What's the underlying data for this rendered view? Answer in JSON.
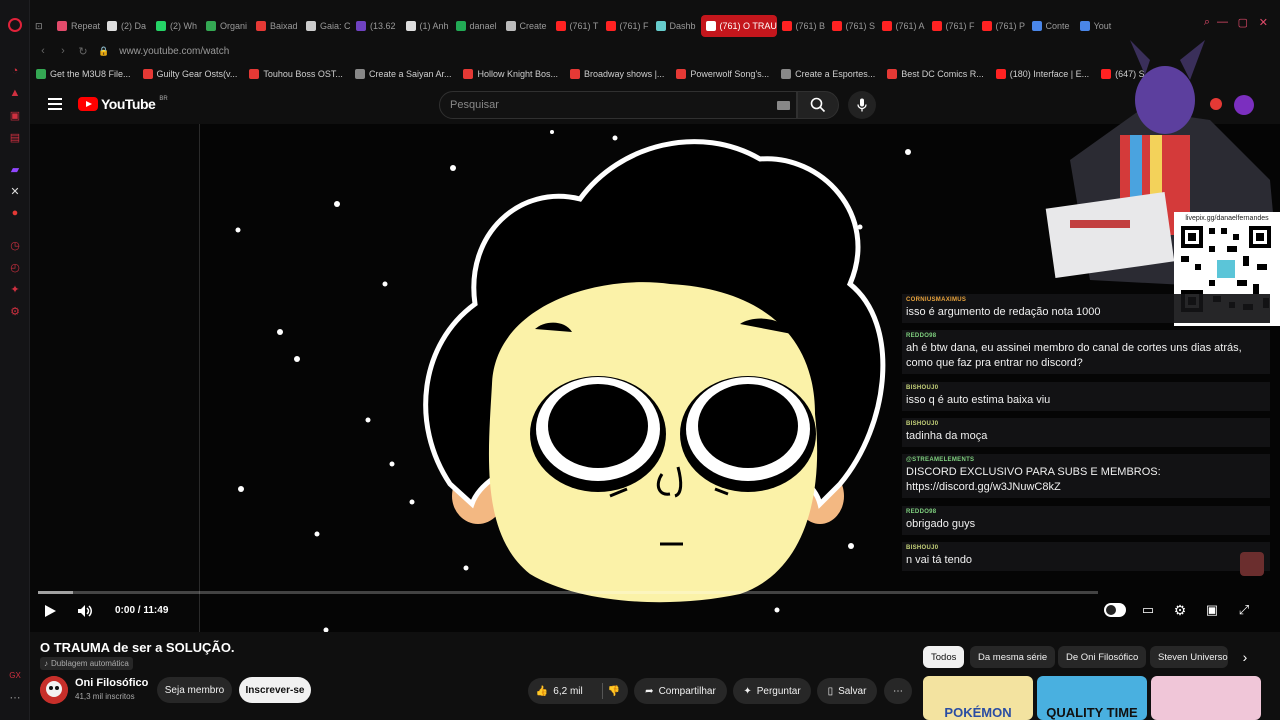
{
  "browser": {
    "tabs": [
      {
        "label": "Repeat",
        "color": "#e24b6b"
      },
      {
        "label": "(2) Da",
        "color": "#dddddd"
      },
      {
        "label": "(2) Wh",
        "color": "#25d366"
      },
      {
        "label": "Organi",
        "color": "#34a853"
      },
      {
        "label": "Baixad",
        "color": "#e53935"
      },
      {
        "label": "Gaia: C",
        "color": "#cccccc"
      },
      {
        "label": "(13.62",
        "color": "#6f42c1"
      },
      {
        "label": "(1) Anh",
        "color": "#dddddd"
      },
      {
        "label": "danael",
        "color": "#22aa55"
      },
      {
        "label": "Create",
        "color": "#bbbbbb"
      },
      {
        "label": "(761) T",
        "color": "#ff2222"
      },
      {
        "label": "(761) F",
        "color": "#ff2222"
      },
      {
        "label": "Dashb",
        "color": "#66cccc"
      },
      {
        "label": "(761) O TRAU",
        "color": "#ffffff"
      },
      {
        "label": "(761) B",
        "color": "#ff2222"
      },
      {
        "label": "(761) S",
        "color": "#ff2222"
      },
      {
        "label": "(761) A",
        "color": "#ff2222"
      },
      {
        "label": "(761) F",
        "color": "#ff2222"
      },
      {
        "label": "(761) P",
        "color": "#ff2222"
      },
      {
        "label": "Conte",
        "color": "#4a86e8"
      },
      {
        "label": "Yout",
        "color": "#4a86e8"
      }
    ],
    "url": "www.youtube.com/watch",
    "bookmarks": [
      {
        "label": "Get the M3U8 File...",
        "color": "#34a853"
      },
      {
        "label": "Guilty Gear Osts(v...",
        "color": "#e53935"
      },
      {
        "label": "Touhou Boss OST...",
        "color": "#e53935"
      },
      {
        "label": "Create a Saiyan Ar...",
        "color": "#888888"
      },
      {
        "label": "Hollow Knight Bos...",
        "color": "#e53935"
      },
      {
        "label": "Broadway shows |...",
        "color": "#e53935"
      },
      {
        "label": "Powerwolf Song's...",
        "color": "#e53935"
      },
      {
        "label": "Create a Esportes...",
        "color": "#888888"
      },
      {
        "label": "Best DC Comics R...",
        "color": "#e53935"
      },
      {
        "label": "(180) Interface | E...",
        "color": "#ff2222"
      },
      {
        "label": "(647) S",
        "color": "#ff2222"
      }
    ]
  },
  "youtube": {
    "logo_text": "YouTube",
    "country_code": "BR",
    "search_placeholder": "Pesquisar",
    "player": {
      "time": "0:00 / 11:49",
      "progress_fraction": 0
    },
    "video_title": "O TRAUMA de ser a SOLUÇÃO.",
    "dubbing_label": "Dublagem automática",
    "channel_name": "Oni Filosófico",
    "subscribers": "41,3 mil inscritos",
    "join_label": "Seja membro",
    "subscribe_label": "Inscrever-se",
    "likes": "6,2 mil",
    "share_label": "Compartilhar",
    "ask_label": "Perguntar",
    "save_label": "Salvar",
    "chips": [
      "Todos",
      "Da mesma série",
      "De Oni Filosófico",
      "Steven Universo"
    ],
    "thumbs": [
      {
        "label": "POKÉMON",
        "bg": "#f3e3a0",
        "fg": "#2a4da3"
      },
      {
        "label": "QUALITY TIME",
        "bg": "#49b0e0",
        "fg": "#111111"
      },
      {
        "label": "",
        "bg": "#f0c6d8",
        "fg": "#111111"
      }
    ]
  },
  "stream_overlay": {
    "qr_caption": "livepix.gg/danaelfernandes",
    "chat": [
      {
        "user": "CORNIUSMAXIMUS",
        "color": "#e8a33c",
        "text": "isso é argumento de redação nota 1000"
      },
      {
        "user": "REDDO98",
        "color": "#7fd07f",
        "text": "ah é btw dana, eu assinei membro do canal de cortes uns dias atrás, como que faz pra entrar no discord?"
      },
      {
        "user": "BISHOUJ0",
        "color": "#c6d37a",
        "text": "isso q é auto estima baixa viu"
      },
      {
        "user": "BISHOUJ0",
        "color": "#c6d37a",
        "text": "tadinha da moça"
      },
      {
        "user": "@STREAMELEMENTS",
        "color": "#7fd07f",
        "text": "DISCORD EXCLUSIVO PARA SUBS E MEMBROS: https://discord.gg/w3JNuwC8kZ"
      },
      {
        "user": "REDDO98",
        "color": "#7fd07f",
        "text": "obrigado guys"
      },
      {
        "user": "BISHOUJ0",
        "color": "#c6d37a",
        "text": "n vai tá tendo"
      }
    ]
  }
}
